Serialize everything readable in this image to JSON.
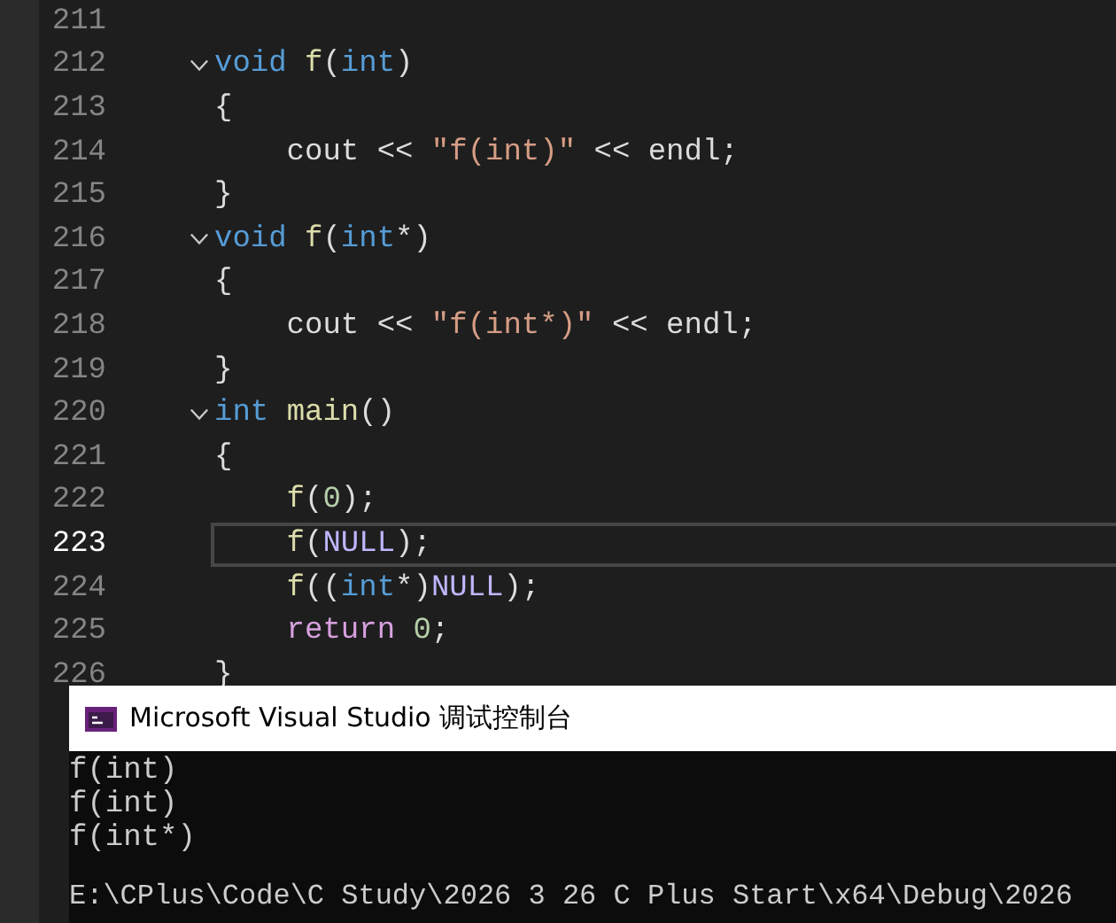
{
  "editor": {
    "lines": [
      {
        "number": "211",
        "current": false,
        "fold": false
      },
      {
        "number": "212",
        "current": false,
        "fold": true,
        "tokens": [
          {
            "kind": "keyword",
            "text": "void "
          },
          {
            "kind": "function",
            "text": "f"
          },
          {
            "kind": "plain",
            "text": "("
          },
          {
            "kind": "keyword",
            "text": "int"
          },
          {
            "kind": "plain",
            "text": ")"
          }
        ]
      },
      {
        "number": "213",
        "current": false,
        "fold": false,
        "tokens": [
          {
            "kind": "plain",
            "text": "{"
          }
        ]
      },
      {
        "number": "214",
        "current": false,
        "fold": false,
        "tokens": [
          {
            "kind": "plain",
            "text": "    cout << "
          },
          {
            "kind": "string",
            "text": "\"f(int)\""
          },
          {
            "kind": "plain",
            "text": " << endl;"
          }
        ]
      },
      {
        "number": "215",
        "current": false,
        "fold": false,
        "tokens": [
          {
            "kind": "plain",
            "text": "}"
          }
        ]
      },
      {
        "number": "216",
        "current": false,
        "fold": true,
        "tokens": [
          {
            "kind": "keyword",
            "text": "void "
          },
          {
            "kind": "function",
            "text": "f"
          },
          {
            "kind": "plain",
            "text": "("
          },
          {
            "kind": "keyword",
            "text": "int"
          },
          {
            "kind": "plain",
            "text": "*)"
          }
        ]
      },
      {
        "number": "217",
        "current": false,
        "fold": false,
        "tokens": [
          {
            "kind": "plain",
            "text": "{"
          }
        ]
      },
      {
        "number": "218",
        "current": false,
        "fold": false,
        "tokens": [
          {
            "kind": "plain",
            "text": "    cout << "
          },
          {
            "kind": "string",
            "text": "\"f(int*)\""
          },
          {
            "kind": "plain",
            "text": " << endl;"
          }
        ]
      },
      {
        "number": "219",
        "current": false,
        "fold": false,
        "tokens": [
          {
            "kind": "plain",
            "text": "}"
          }
        ]
      },
      {
        "number": "220",
        "current": false,
        "fold": true,
        "tokens": [
          {
            "kind": "keyword",
            "text": "int "
          },
          {
            "kind": "function",
            "text": "main"
          },
          {
            "kind": "plain",
            "text": "()"
          }
        ]
      },
      {
        "number": "221",
        "current": false,
        "fold": false,
        "tokens": [
          {
            "kind": "plain",
            "text": "{"
          }
        ]
      },
      {
        "number": "222",
        "current": false,
        "fold": false,
        "tokens": [
          {
            "kind": "function",
            "text": "    f"
          },
          {
            "kind": "plain",
            "text": "("
          },
          {
            "kind": "number",
            "text": "0"
          },
          {
            "kind": "plain",
            "text": ");"
          }
        ]
      },
      {
        "number": "223",
        "current": true,
        "fold": false,
        "tokens": [
          {
            "kind": "function",
            "text": "    f"
          },
          {
            "kind": "plain",
            "text": "("
          },
          {
            "kind": "macro",
            "text": "NULL"
          },
          {
            "kind": "plain",
            "text": ");"
          }
        ]
      },
      {
        "number": "224",
        "current": false,
        "fold": false,
        "tokens": [
          {
            "kind": "function",
            "text": "    f"
          },
          {
            "kind": "plain",
            "text": "(("
          },
          {
            "kind": "keyword",
            "text": "int"
          },
          {
            "kind": "plain",
            "text": "*)"
          },
          {
            "kind": "macro",
            "text": "NULL"
          },
          {
            "kind": "plain",
            "text": ");"
          }
        ]
      },
      {
        "number": "225",
        "current": false,
        "fold": false,
        "tokens": [
          {
            "kind": "control",
            "text": "    return "
          },
          {
            "kind": "number",
            "text": "0"
          },
          {
            "kind": "plain",
            "text": ";"
          }
        ]
      },
      {
        "number": "226",
        "current": false,
        "fold": false,
        "tokens": [
          {
            "kind": "plain",
            "text": "}"
          }
        ]
      }
    ]
  },
  "console": {
    "title": "Microsoft Visual Studio 调试控制台",
    "output": [
      "f(int)",
      "f(int)",
      "f(int*)"
    ],
    "path": "E:\\CPlus\\Code\\C Study\\2026 3 26 C Plus Start\\x64\\Debug\\2026"
  }
}
